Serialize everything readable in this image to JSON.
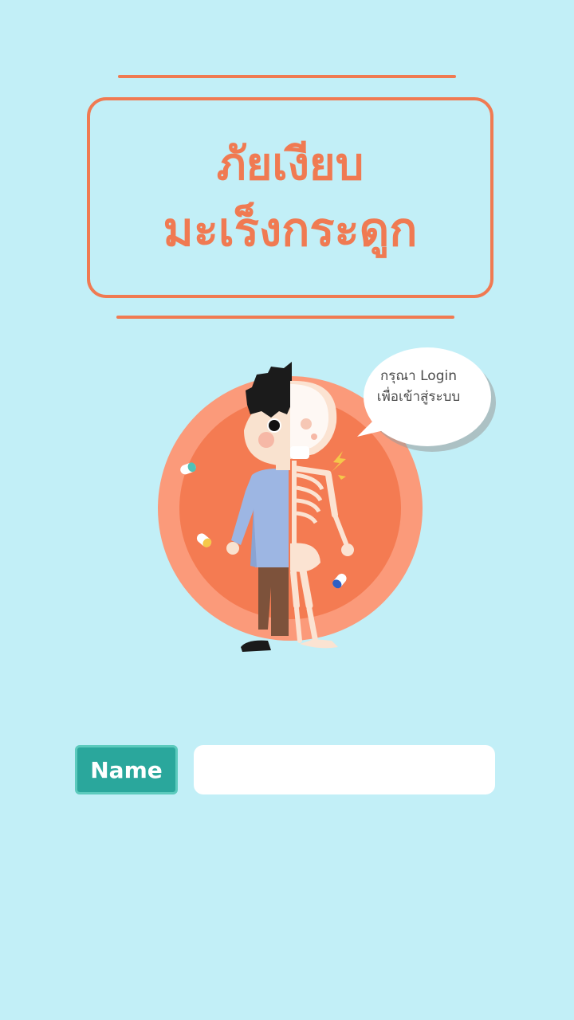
{
  "header": {
    "title_line1": "ภัยเงียบ",
    "title_line2": "มะเร็งกระดูก"
  },
  "speech_bubble": {
    "line1": "กรุณา Login",
    "line2": "เพื่อเข้าสู่ระบบ"
  },
  "login_form": {
    "name_label": "Name",
    "name_value": "",
    "name_placeholder": ""
  },
  "colors": {
    "background": "#c2eff7",
    "accent": "#f07a52",
    "label_bg": "#2aa79c",
    "input_bg": "#ffffff"
  },
  "illustration": {
    "icons": [
      "half-man-half-skeleton",
      "orange-circle-backdrop",
      "pill-capsule-icon",
      "lightning-bolt-icon",
      "speech-bubble"
    ]
  }
}
